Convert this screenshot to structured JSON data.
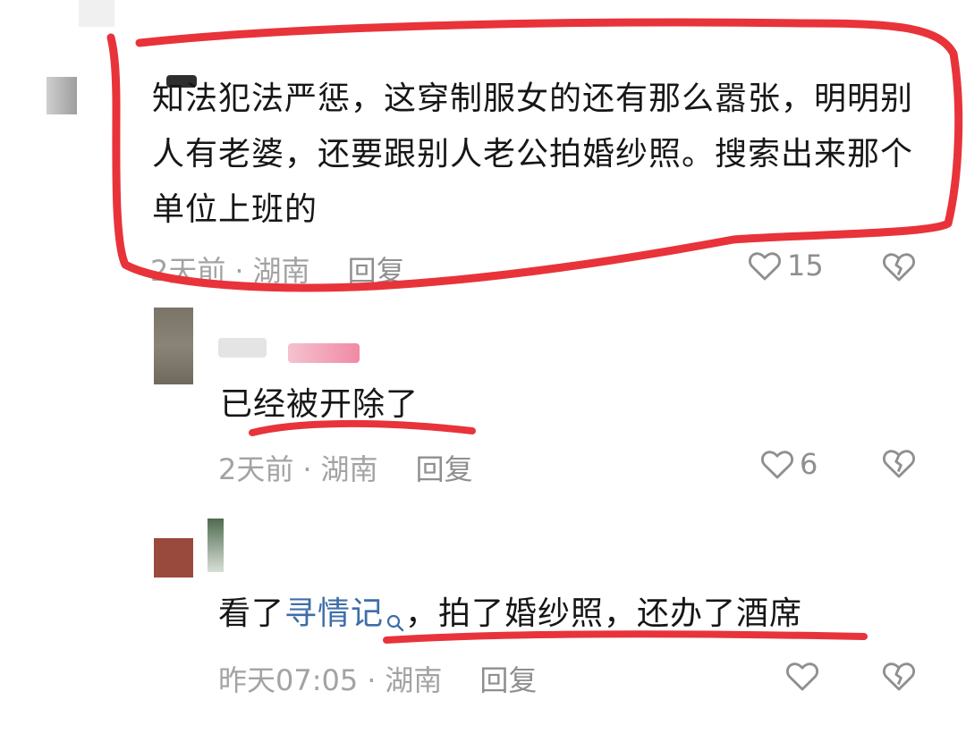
{
  "comments": [
    {
      "text": "知法犯法严惩，这穿制服女的还有那么嚣张，明明别人有老婆，还要跟别人老公拍婚纱照。搜索出来那个单位上班的",
      "time": "2天前",
      "location": "湖南",
      "reply_label": "回复",
      "likes": "15"
    },
    {
      "text": "已经被开除了",
      "time": "2天前",
      "location": "湖南",
      "reply_label": "回复",
      "likes": "6"
    },
    {
      "text_before": "看了",
      "link_text": "寻情记",
      "text_after": "，拍了婚纱照，还办了酒席",
      "time": "昨天07:05",
      "location": "湖南",
      "reply_label": "回复",
      "likes": ""
    }
  ],
  "separator": "·",
  "icons": [
    "heart-outline-icon",
    "broken-heart-icon",
    "search-icon"
  ],
  "colors": {
    "annotation_red": "#e8333a",
    "link_blue": "#3f6ea8",
    "meta_gray": "#a3a3a3"
  }
}
